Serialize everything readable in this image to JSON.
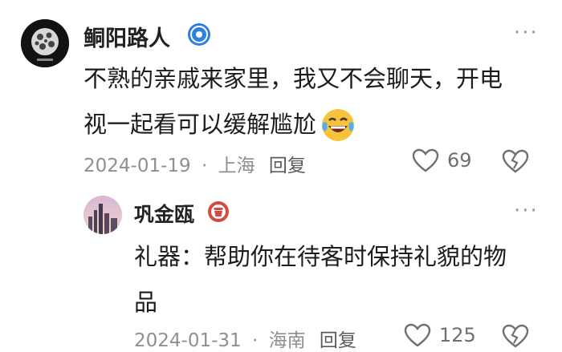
{
  "comments": [
    {
      "username": "鲖阳路人",
      "text_line1": "不熟的亲戚来家里，我又不会聊天，开电",
      "text_line2": "视一起看可以缓解尴尬",
      "date": "2024-01-19",
      "location": "上海",
      "reply_label": "回复",
      "like_count": "69",
      "emoji": "crying-laughing"
    },
    {
      "username": "巩金瓯",
      "text_line1": "礼器：帮助你在待客时保持礼貌的物",
      "text_line2": "品",
      "date": "2024-01-31",
      "location": "海南",
      "reply_label": "回复",
      "like_count": "125"
    }
  ],
  "separator": "·",
  "more_glyph": "···"
}
